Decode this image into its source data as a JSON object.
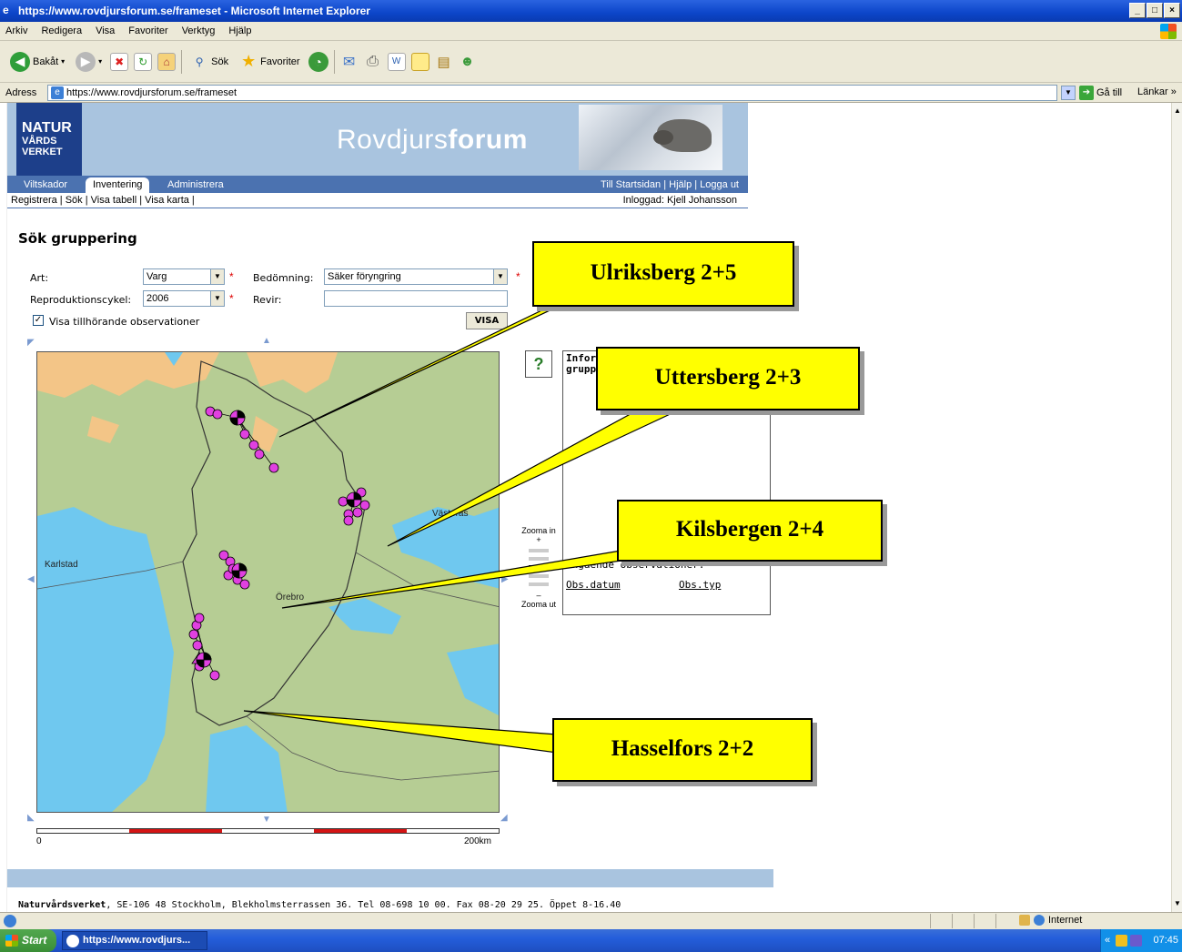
{
  "window": {
    "title": "https://www.rovdjursforum.se/frameset - Microsoft Internet Explorer",
    "min": "_",
    "max": "□",
    "close": "×"
  },
  "menu": [
    "Arkiv",
    "Redigera",
    "Visa",
    "Favoriter",
    "Verktyg",
    "Hjälp"
  ],
  "toolbar": {
    "back": "Bakåt",
    "search": "Sök",
    "favorites": "Favoriter"
  },
  "address": {
    "label": "Adress",
    "url": "https://www.rovdjursforum.se/frameset",
    "go": "Gå till",
    "links": "Länkar"
  },
  "site": {
    "logo_line1": "NATUR",
    "logo_line2": "VÅRDS",
    "logo_line3": "VERKET",
    "title_light": "Rovdjurs",
    "title_bold": "forum",
    "tabs": [
      "Viltskador",
      "Inventering",
      "Administrera"
    ],
    "top_links": "Till Startsidan  |  Hjälp  |  Logga ut",
    "sub_nav": "Registrera  |  Sök  |  Visa tabell  |  Visa karta  |",
    "logged_in": "Inloggad: Kjell Johansson"
  },
  "form": {
    "heading": "Sök gruppering",
    "art_label": "Art:",
    "art_value": "Varg",
    "bedomning_label": "Bedömning:",
    "bedomning_value": "Säker föryngring",
    "cykel_label": "Reproduktionscykel:",
    "cykel_value": "2006",
    "revir_label": "Revir:",
    "checkbox_label": "Visa tillhörande observationer",
    "checkbox_mark": "✓",
    "required": "*",
    "submit": "VISA"
  },
  "map": {
    "cities": {
      "karlstad": "Karlstad",
      "orebro": "Örebro",
      "vasteras": "Västerås"
    },
    "scale_start": "0",
    "scale_end": "200km",
    "zoom_in": "Zooma in",
    "zoom_plus": "+",
    "zoom_minus": "–",
    "zoom_out": "Zooma ut"
  },
  "info_panel": {
    "help": "?",
    "title_line1": "Infor",
    "title_line2": "grupp",
    "obs_heading": "Ingående observationer:",
    "col_date": "Obs.datum",
    "col_type": "Obs.typ"
  },
  "callouts": [
    "Ulriksberg 2+5",
    "Uttersberg 2+3",
    "Kilsbergen 2+4",
    "Hasselfors 2+2"
  ],
  "footer": {
    "org": "Naturvårdsverket",
    "text": ", SE-106 48 Stockholm, Blekholmsterrassen 36. Tel 08-698 10 00. Fax 08-20 29 25. Öppet 8-16.40"
  },
  "status": {
    "zone": "Internet"
  },
  "taskbar": {
    "start": "Start",
    "task": "https://www.rovdjurs...",
    "tray_prefix": "«",
    "clock": "07:45"
  },
  "colors": {
    "land": "#b6cd94",
    "water": "#6fc8ef",
    "forest_light": "#f3c587",
    "marker": "#e040e0",
    "callout": "#ffff00"
  }
}
